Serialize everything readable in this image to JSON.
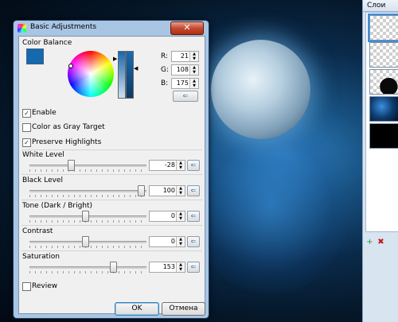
{
  "dialog": {
    "title": "Basic Adjustments",
    "close_glyph": "✕",
    "color_balance_label": "Color Balance",
    "rgb": {
      "r_label": "R:",
      "r_value": "21",
      "g_label": "G:",
      "g_value": "108",
      "b_label": "B:",
      "b_value": "175"
    },
    "swatch_color": "#1569af",
    "checkboxes": {
      "enable": {
        "label": "Enable",
        "checked": true
      },
      "gray_target": {
        "label": "Color as Gray Target",
        "checked": false
      },
      "preserve": {
        "label": "Preserve Highlights",
        "checked": true
      },
      "review": {
        "label": "Review",
        "checked": false
      }
    },
    "check_glyph": "✓",
    "reset_glyph": "⇐",
    "sliders": [
      {
        "label": "White Level",
        "value": "-28"
      },
      {
        "label": "Black Level",
        "value": "100"
      },
      {
        "label": "Tone (Dark / Bright)",
        "value": "0"
      },
      {
        "label": "Contrast",
        "value": "0"
      },
      {
        "label": "Saturation",
        "value": "153"
      }
    ],
    "ok_label": "OK",
    "cancel_label": "Отмена"
  },
  "layers_panel": {
    "title": "Слои",
    "add_glyph": "+",
    "delete_glyph": "✖"
  }
}
